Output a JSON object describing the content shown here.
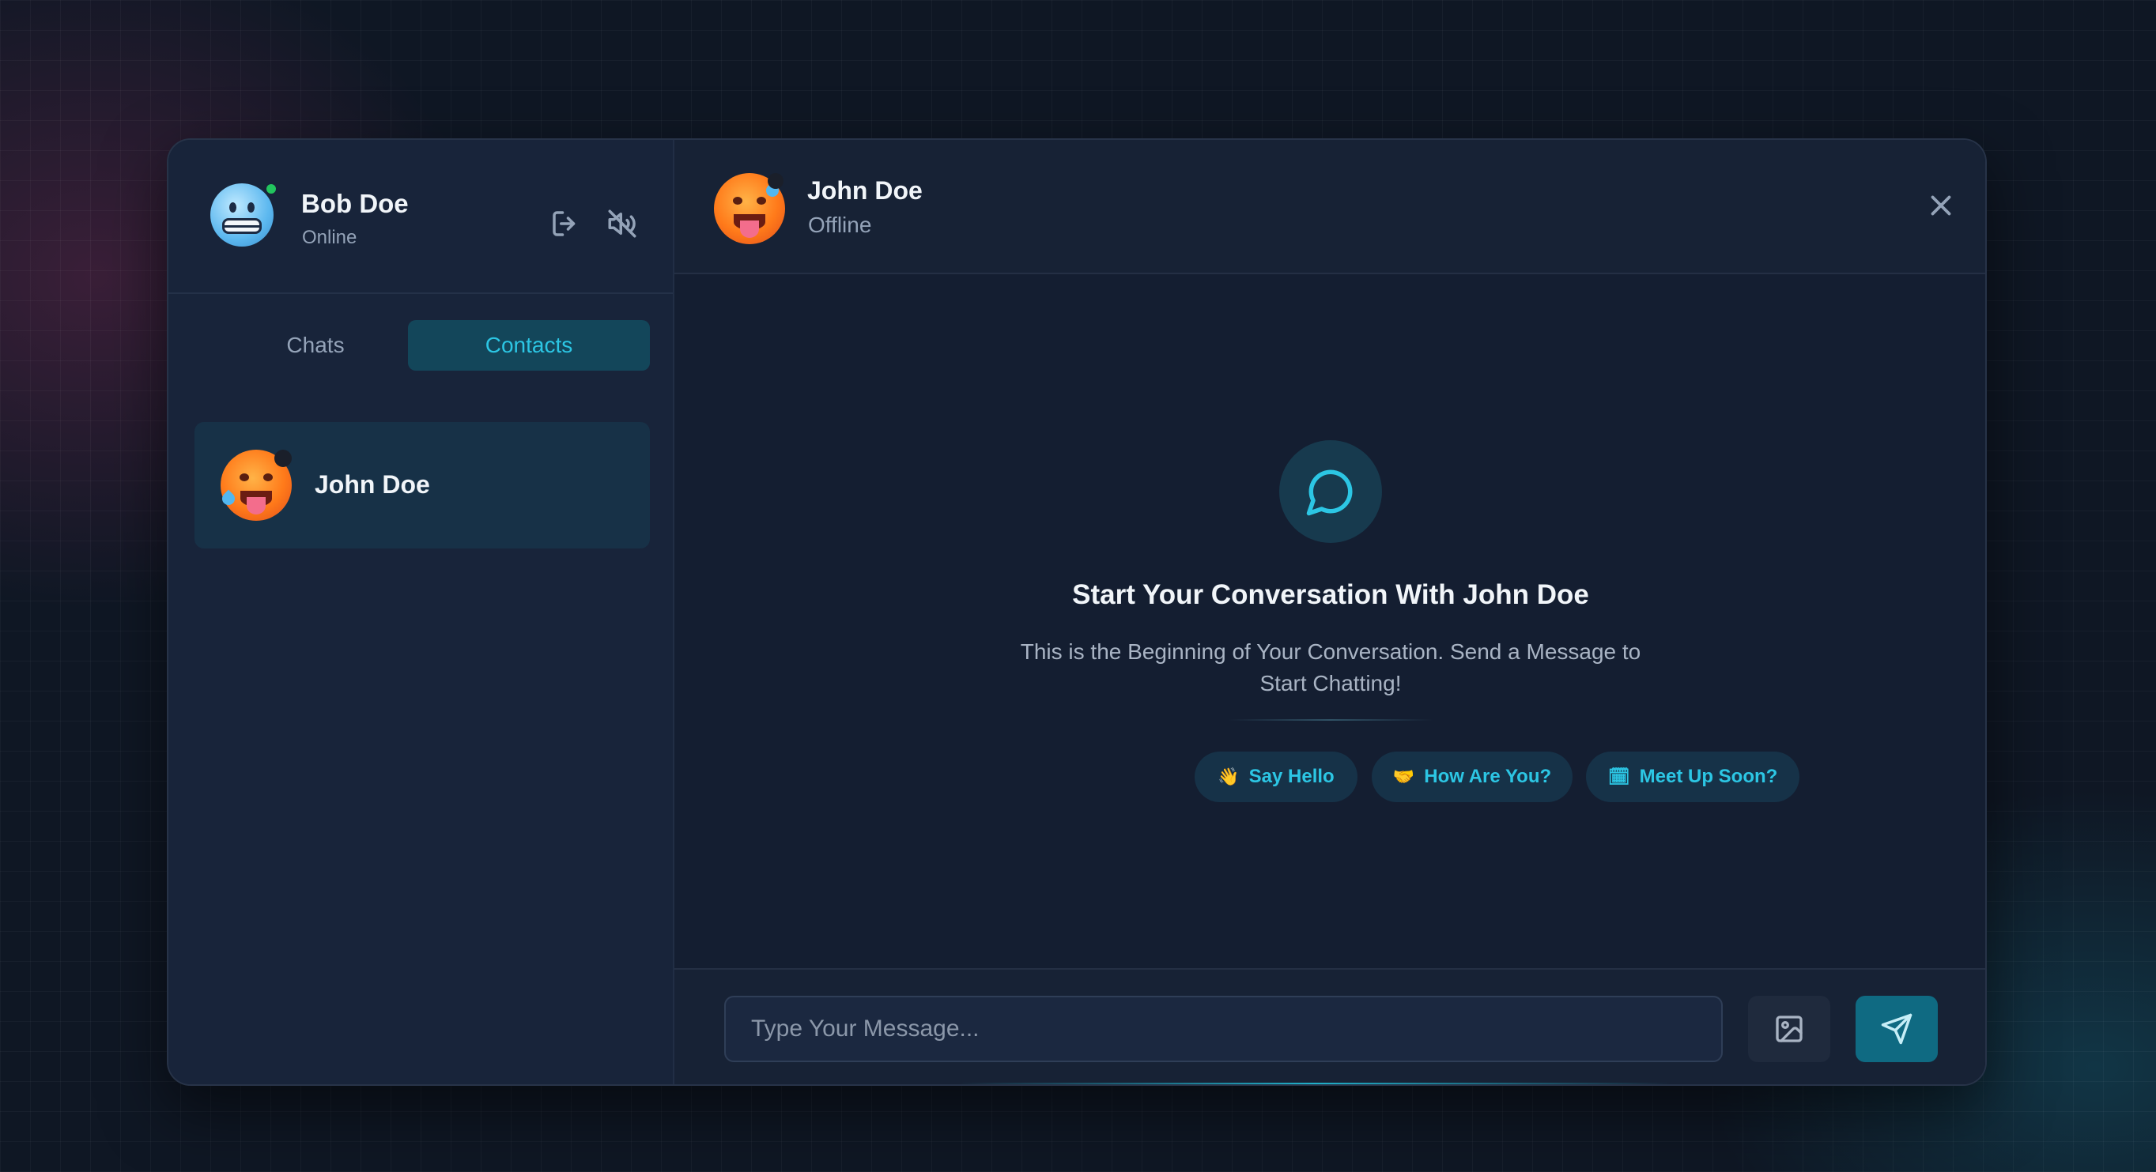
{
  "current_user": {
    "name": "Bob Doe",
    "status": "Online",
    "avatar": "cold-face-emoji"
  },
  "sidebar": {
    "actions": [
      {
        "icon": "logout-icon",
        "label": "Logout"
      },
      {
        "icon": "sound-off-icon",
        "label": "Sound off"
      }
    ],
    "tabs": [
      {
        "label": "Chats",
        "active": false
      },
      {
        "label": "Contacts",
        "active": true
      }
    ],
    "contacts": [
      {
        "name": "John Doe",
        "avatar": "hot-face-emoji"
      }
    ]
  },
  "chat": {
    "peer": {
      "name": "John Doe",
      "status": "Offline",
      "avatar": "hot-face-emoji"
    },
    "empty_state": {
      "icon": "message-circle-icon",
      "title": "Start Your Conversation With John Doe",
      "text": "This is the Beginning of Your Conversation. Send a Message to Start Chatting!"
    },
    "suggestions": [
      {
        "emoji": "👋",
        "label": "Say Hello"
      },
      {
        "emoji": "🤝",
        "label": "How Are You?"
      },
      {
        "emoji": "🗓",
        "label": "Meet Up Soon?"
      }
    ],
    "composer": {
      "placeholder": "Type Your Message...",
      "value": ""
    }
  },
  "colors": {
    "accent": "#2cc6e4",
    "online": "#22c55e",
    "background": "#0f1724"
  }
}
